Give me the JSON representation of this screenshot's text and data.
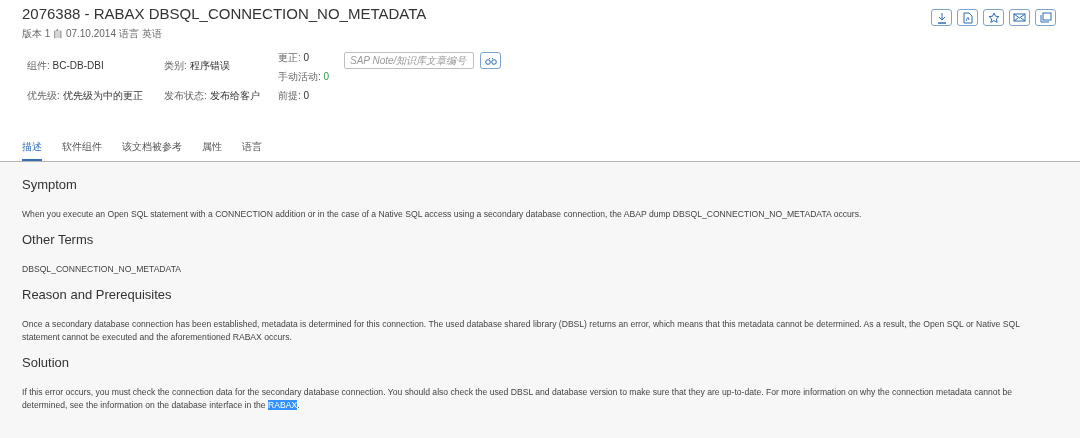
{
  "header": {
    "title": "2076388 - RABAX DBSQL_CONNECTION_NO_METADATA",
    "subtitle": "版本 1 自 07.10.2014 语言 英语",
    "actions": [
      {
        "kind": "download"
      },
      {
        "kind": "pdf"
      },
      {
        "kind": "favorite"
      },
      {
        "kind": "email"
      },
      {
        "kind": "copy"
      }
    ]
  },
  "attributes": [
    [
      {
        "label": "组件:",
        "value": "BC-DB-DBI",
        "kind": "plain"
      },
      {
        "label": "优先级:",
        "value": "优先级为中的更正",
        "kind": "plain"
      }
    ],
    [
      {
        "label": "类别:",
        "value": "程序错误",
        "kind": "plain"
      },
      {
        "label": "发布状态:",
        "value": "发布给客户",
        "kind": "plain"
      }
    ],
    [
      {
        "label": "更正:",
        "value": "0",
        "kind": "plain"
      },
      {
        "label": "手动活动:",
        "value": "0",
        "kind": "link"
      },
      {
        "label": "前提:",
        "value": "0",
        "kind": "plain"
      }
    ]
  ],
  "search": {
    "placeholder": "SAP Note/知识库文章编号"
  },
  "tabs": [
    {
      "label": "描述",
      "selected": true
    },
    {
      "label": "软件组件",
      "selected": false
    },
    {
      "label": "该文档被参考",
      "selected": false
    },
    {
      "label": "属性",
      "selected": false
    },
    {
      "label": "语言",
      "selected": false
    }
  ],
  "sections": [
    {
      "heading": "Symptom",
      "parts": [
        {
          "text": "When you execute an Open SQL statement with a CONNECTION addition or in the case of a Native SQL access using a secondary database connection, the ABAP dump DBSQL_CONNECTION_NO_METADATA occurs.",
          "selected": false
        }
      ]
    },
    {
      "heading": "Other Terms",
      "parts": [
        {
          "text": "DBSQL_CONNECTION_NO_METADATA",
          "selected": false
        }
      ]
    },
    {
      "heading": "Reason and Prerequisites",
      "parts": [
        {
          "text": "Once a secondary database connection has been established, metadata is determined for this connection. The used database shared library (DBSL) returns an error, which means that this metadata cannot be determined. As a result, the Open SQL or Native SQL statement cannot be executed and the aforementioned RABAX occurs.",
          "selected": false
        }
      ]
    },
    {
      "heading": "Solution",
      "parts": [
        {
          "text": "If this error occurs, you must check the connection data for the secondary database connection. You should also check the used DBSL and database version to make sure that they are up-to-date. For more information on why the connection metadata cannot be determined, see the information on the database interface in the ",
          "selected": false
        },
        {
          "text": "RABAX",
          "selected": true
        },
        {
          "text": ".",
          "selected": false
        }
      ]
    }
  ]
}
